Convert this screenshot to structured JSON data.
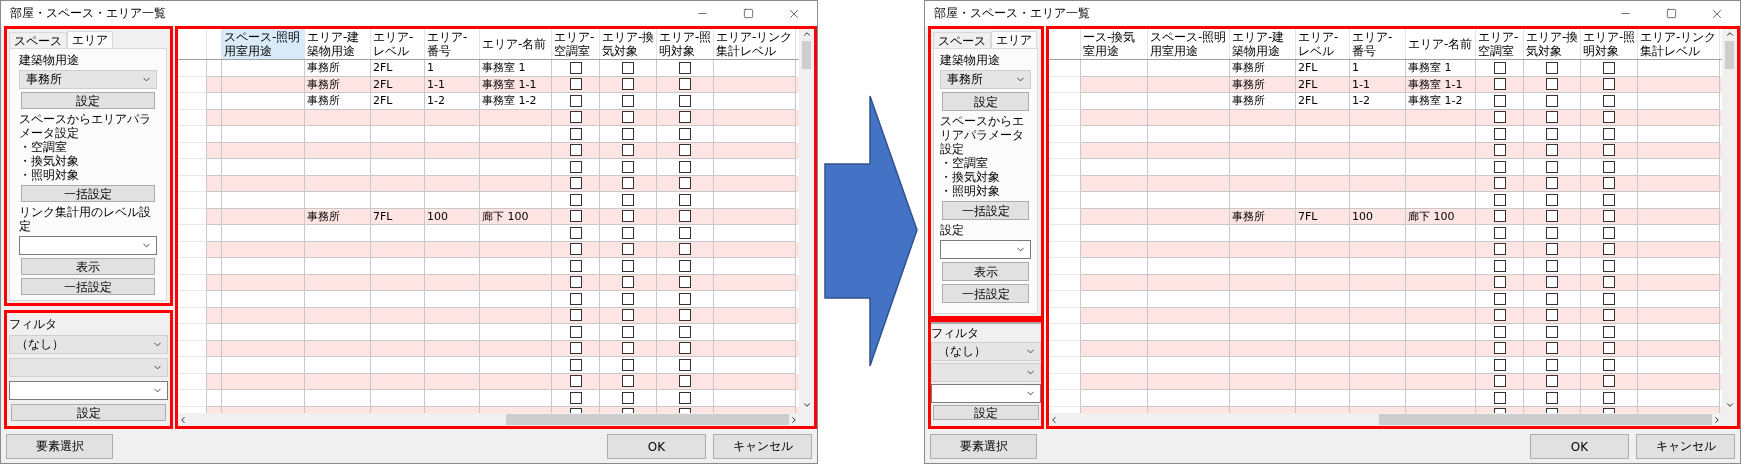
{
  "windows": [
    {
      "kind": "wide",
      "title": "部屋・スペース・エリア一覧",
      "tabs": [
        {
          "label": "スペース",
          "selected": false
        },
        {
          "label": "エリア",
          "selected": true
        }
      ],
      "panel_items": [
        {
          "kind": "label",
          "text": "建築物用途"
        },
        {
          "kind": "select",
          "value": "事務所"
        },
        {
          "kind": "button",
          "text": "設定"
        },
        {
          "kind": "note",
          "lines": [
            "スペースからエリアパラメータ設定",
            "・空調室",
            "・換気対象",
            "・照明対象"
          ]
        },
        {
          "kind": "button",
          "text": "一括設定"
        },
        {
          "kind": "label",
          "text": "リンク集計用のレベル設定"
        },
        {
          "kind": "combo"
        },
        {
          "kind": "button",
          "text": "表示"
        },
        {
          "kind": "button",
          "text": "一括設定"
        }
      ],
      "filter": {
        "label": "フィルタ",
        "items": [
          {
            "kind": "select",
            "value": "（なし）"
          },
          {
            "kind": "select"
          },
          {
            "kind": "combo"
          },
          {
            "kind": "button",
            "text": "設定"
          }
        ]
      },
      "columns": [
        {
          "kind": "blank",
          "selected": false
        },
        {
          "kind": "blank",
          "label": [
            "スペース-照明",
            "用室用途"
          ],
          "selected": true
        },
        {
          "kind": "use",
          "label": [
            "エリア-建",
            "築物用途"
          ],
          "selected": false
        },
        {
          "kind": "level",
          "label": [
            "エリア-",
            "レベル"
          ],
          "selected": false
        },
        {
          "kind": "number",
          "label": [
            "エリア-",
            "番号"
          ],
          "selected": false
        },
        {
          "kind": "name",
          "label": [
            "エリア-名前"
          ],
          "selected": false
        },
        {
          "kind": "check",
          "label": [
            "エリア-",
            "空調室"
          ],
          "selected": false
        },
        {
          "kind": "check",
          "label": [
            "エリア-換",
            "気対象"
          ],
          "selected": false
        },
        {
          "kind": "check",
          "label": [
            "エリア-照",
            "明対象"
          ],
          "selected": false
        },
        {
          "kind": "link",
          "label": [
            "エリア-リンク",
            "集計レベル"
          ],
          "selected": false
        }
      ],
      "rows": [
        {
          "use": "事務所",
          "level": "2FL",
          "number": "1",
          "name": "事務室 1",
          "checks": [
            false,
            false,
            false
          ]
        },
        {
          "use": "事務所",
          "level": "2FL",
          "number": "1-1",
          "name": "事務室 1-1",
          "checks": [
            false,
            false,
            false
          ]
        },
        {
          "use": "事務所",
          "level": "2FL",
          "number": "1-2",
          "name": "事務室 1-2",
          "checks": [
            false,
            false,
            false
          ]
        },
        {
          "checks": [
            false,
            false,
            false
          ]
        },
        {
          "checks": [
            false,
            false,
            false
          ]
        },
        {
          "checks": [
            false,
            false,
            false
          ]
        },
        {
          "checks": [
            false,
            false,
            false
          ]
        },
        {
          "checks": [
            false,
            false,
            false
          ]
        },
        {
          "checks": [
            false,
            false,
            false
          ]
        },
        {
          "use": "事務所",
          "level": "7FL",
          "number": "100",
          "name": "廊下 100",
          "checks": [
            false,
            false,
            false
          ]
        },
        {
          "checks": [
            false,
            false,
            false
          ]
        },
        {
          "checks": [
            false,
            false,
            false
          ]
        },
        {
          "checks": [
            false,
            false,
            false
          ]
        },
        {
          "checks": [
            false,
            false,
            false
          ]
        },
        {
          "checks": [
            false,
            false,
            false
          ]
        },
        {
          "checks": [
            false,
            false,
            false
          ]
        },
        {
          "checks": [
            false,
            false,
            false
          ]
        },
        {
          "checks": [
            false,
            false,
            false
          ]
        },
        {
          "checks": [
            false,
            false,
            false
          ]
        },
        {
          "checks": [
            false,
            false,
            false
          ]
        },
        {
          "checks": [
            false,
            false,
            false
          ]
        },
        {
          "checks": [
            false,
            false,
            false
          ]
        }
      ],
      "footer_buttons": [
        "要素選択",
        "OK",
        "キャンセル"
      ]
    },
    {
      "kind": "narrow",
      "title": "部屋・スペース・エリア一覧",
      "tabs": [
        {
          "label": "スペース",
          "selected": false
        },
        {
          "label": "エリア",
          "selected": true
        }
      ],
      "panel_items": [
        {
          "kind": "label",
          "text": "建築物用途"
        },
        {
          "kind": "select",
          "value": "事務所"
        },
        {
          "kind": "button",
          "text": "設定"
        },
        {
          "kind": "note",
          "lines": [
            "スペースからエリアパラメータ設定",
            "・空調室",
            "・換気対象",
            "・照明対象"
          ]
        },
        {
          "kind": "button",
          "text": "一括設定"
        },
        {
          "kind": "label",
          "text": "設定"
        },
        {
          "kind": "combo"
        },
        {
          "kind": "button",
          "text": "表示"
        },
        {
          "kind": "button",
          "text": "一括設定"
        }
      ],
      "filter": {
        "label": "フィルタ",
        "items": [
          {
            "kind": "select",
            "value": "（なし）"
          },
          {
            "kind": "select"
          },
          {
            "kind": "combo"
          },
          {
            "kind": "button",
            "text": "設定"
          }
        ]
      },
      "columns": [
        {
          "kind": "blank",
          "label": [
            "ース-換気",
            "室用途"
          ],
          "selected": false
        },
        {
          "kind": "blank",
          "label": [
            "スペース-照明",
            "用室用途"
          ],
          "selected": false
        },
        {
          "kind": "use",
          "label": [
            "エリア-建",
            "築物用途"
          ],
          "selected": false
        },
        {
          "kind": "level",
          "label": [
            "エリア-",
            "レベル"
          ],
          "selected": false
        },
        {
          "kind": "number",
          "label": [
            "エリア-",
            "番号"
          ],
          "selected": false
        },
        {
          "kind": "name",
          "label": [
            "エリア-名前"
          ],
          "selected": false
        },
        {
          "kind": "check",
          "label": [
            "エリア-",
            "空調室"
          ],
          "selected": false
        },
        {
          "kind": "check",
          "label": [
            "エリア-換",
            "気対象"
          ],
          "selected": false
        },
        {
          "kind": "check",
          "label": [
            "エリア-照",
            "明対象"
          ],
          "selected": false
        },
        {
          "kind": "link",
          "label": [
            "エリア-リンク",
            "集計レベル"
          ],
          "selected": false
        }
      ],
      "rows": [
        {
          "use": "事務所",
          "level": "2FL",
          "number": "1",
          "name": "事務室 1",
          "checks": [
            false,
            false,
            false
          ]
        },
        {
          "use": "事務所",
          "level": "2FL",
          "number": "1-1",
          "name": "事務室 1-1",
          "checks": [
            false,
            false,
            false
          ]
        },
        {
          "use": "事務所",
          "level": "2FL",
          "number": "1-2",
          "name": "事務室 1-2",
          "checks": [
            false,
            false,
            false
          ]
        },
        {
          "checks": [
            false,
            false,
            false
          ]
        },
        {
          "checks": [
            false,
            false,
            false
          ]
        },
        {
          "checks": [
            false,
            false,
            false
          ]
        },
        {
          "checks": [
            false,
            false,
            false
          ]
        },
        {
          "checks": [
            false,
            false,
            false
          ]
        },
        {
          "checks": [
            false,
            false,
            false
          ]
        },
        {
          "use": "事務所",
          "level": "7FL",
          "number": "100",
          "name": "廊下 100",
          "checks": [
            false,
            false,
            false
          ]
        },
        {
          "checks": [
            false,
            false,
            false
          ]
        },
        {
          "checks": [
            false,
            false,
            false
          ]
        },
        {
          "checks": [
            false,
            false,
            false
          ]
        },
        {
          "checks": [
            false,
            false,
            false
          ]
        },
        {
          "checks": [
            false,
            false,
            false
          ]
        },
        {
          "checks": [
            false,
            false,
            false
          ]
        },
        {
          "checks": [
            false,
            false,
            false
          ]
        },
        {
          "checks": [
            false,
            false,
            false
          ]
        },
        {
          "checks": [
            false,
            false,
            false
          ]
        },
        {
          "checks": [
            false,
            false,
            false
          ]
        },
        {
          "checks": [
            false,
            false,
            false
          ]
        },
        {
          "checks": [
            false,
            false,
            false
          ]
        }
      ],
      "footer_buttons": [
        "要素選択",
        "OK",
        "キャンセル"
      ]
    }
  ]
}
